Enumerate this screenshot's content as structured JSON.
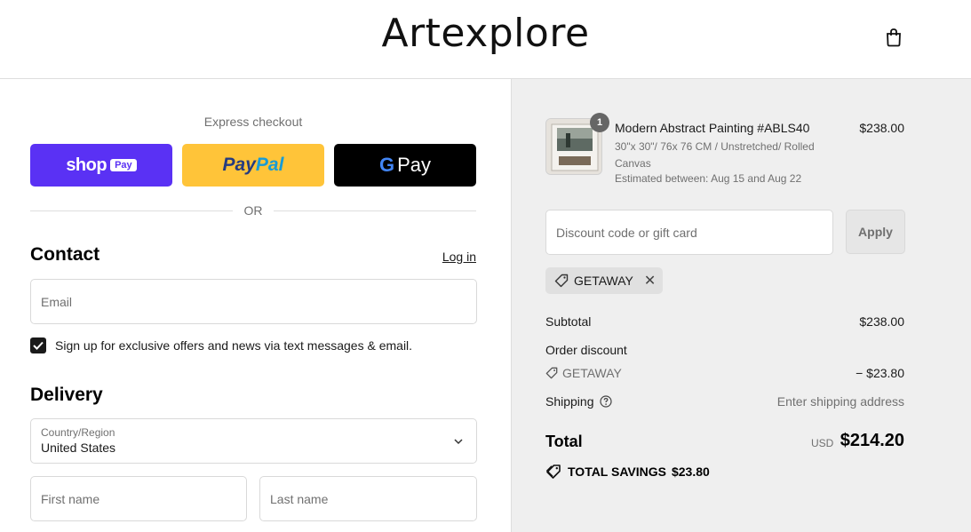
{
  "header": {
    "brand": "Artexplore",
    "cart_icon": "shopping-bag-icon"
  },
  "express": {
    "title": "Express checkout",
    "shop_word": "shop",
    "shop_badge": "Pay",
    "paypal_part1": "Pay",
    "paypal_part2": "Pal",
    "gpay_letter": "G",
    "gpay_word": "Pay",
    "or": "OR"
  },
  "contact": {
    "title": "Contact",
    "login": "Log in",
    "email_placeholder": "Email",
    "signup_label": "Sign up for exclusive offers and news via text messages & email.",
    "signup_checked": true
  },
  "delivery": {
    "title": "Delivery",
    "country_label": "Country/Region",
    "country_value": "United States",
    "first_name_placeholder": "First name",
    "last_name_placeholder": "Last name"
  },
  "order": {
    "product": {
      "quantity": "1",
      "name": "Modern Abstract Painting #ABLS40",
      "variant": "30\"x 30\"/ 76x 76 CM / Unstretched/ Rolled Canvas",
      "estimate": "Estimated between: Aug 15 and Aug 22",
      "price": "$238.00"
    },
    "discount_placeholder": "Discount code or gift card",
    "apply_label": "Apply",
    "applied_code": "GETAWAY",
    "subtotal_label": "Subtotal",
    "subtotal_value": "$238.00",
    "order_discount_label": "Order discount",
    "discount_code": "GETAWAY",
    "discount_value": "− $23.80",
    "shipping_label": "Shipping",
    "shipping_value": "Enter shipping address",
    "total_label": "Total",
    "currency": "USD",
    "total_value": "$214.20",
    "savings_label": "TOTAL SAVINGS",
    "savings_value": "$23.80"
  },
  "colors": {
    "shop_pay": "#5a31f4",
    "paypal": "#ffc439",
    "gpay": "#000000",
    "summary_bg": "#efefef"
  }
}
